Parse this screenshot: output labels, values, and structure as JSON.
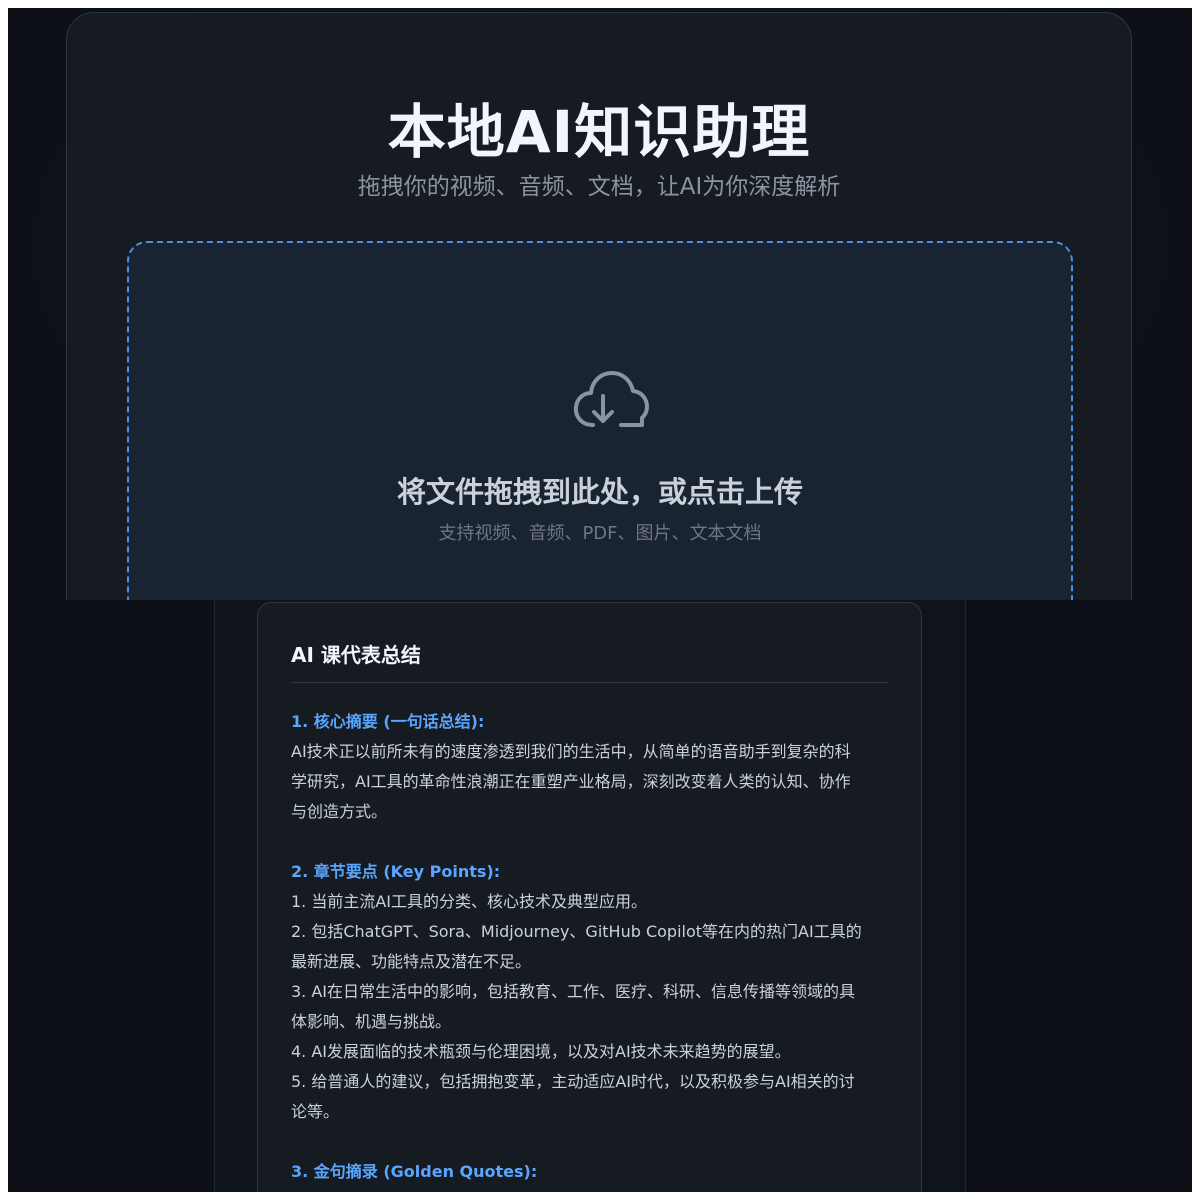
{
  "app": {
    "title": "本地AI知识助理",
    "subtitle": "拖拽你的视频、音频、文档，让AI为你深度解析"
  },
  "dropzone": {
    "icon": "cloud-download-icon",
    "title": "将文件拖拽到此处，或点击上传",
    "hint": "支持视频、音频、PDF、图片、文本文档"
  },
  "summary": {
    "title": "AI 课代表总结",
    "sections": {
      "core": {
        "heading": "1. 核心摘要 (一句话总结):",
        "lines": [
          "AI技术正以前所未有的速度渗透到我们的生活中，从简单的语音助手到复杂的科",
          "学研究，AI工具的革命性浪潮正在重塑产业格局，深刻改变着人类的认知、协作",
          "与创造方式。"
        ]
      },
      "key_points": {
        "heading": "2. 章节要点 (Key Points):",
        "lines": [
          "1. 当前主流AI工具的分类、核心技术及典型应用。",
          "2. 包括ChatGPT、Sora、Midjourney、GitHub Copilot等在内的热门AI工具的",
          "最新进展、功能特点及潜在不足。",
          "3. AI在日常生活中的影响，包括教育、工作、医疗、科研、信息传播等领域的具",
          "体影响、机遇与挑战。",
          "4. AI发展面临的技术瓶颈与伦理困境，以及对AI技术未来趋势的展望。",
          "5. 给普通人的建议，包括拥抱变革，主动适应AI时代，以及积极参与AI相关的讨",
          "论等。"
        ]
      },
      "quotes": {
        "heading": "3. 金句摘录 (Golden Quotes):"
      }
    }
  },
  "colors": {
    "background": "#0d1117",
    "card": "#161b22",
    "accent": "#58a6ff",
    "dropzone_border": "#4a8fe0"
  }
}
